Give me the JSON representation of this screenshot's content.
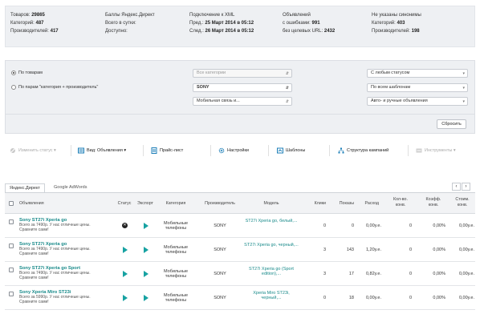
{
  "stats": {
    "col1": {
      "items": [
        {
          "label": "Товаров:",
          "value": "29865"
        },
        {
          "label": "Категорий:",
          "value": "487"
        },
        {
          "label": "Производителей:",
          "value": "417"
        }
      ]
    },
    "col2": {
      "items": [
        {
          "label": "Баллы Яндекс.Директ",
          "value": ""
        },
        {
          "label": "Всего в сутки:",
          "value": ""
        },
        {
          "label": "Доступно:",
          "value": ""
        }
      ]
    },
    "col3": {
      "items": [
        {
          "label": "Подключение к XML",
          "value": ""
        },
        {
          "label": "Пред.:",
          "value": "25 Март 2014 в 05:12"
        },
        {
          "label": "След.:",
          "value": "26 Март 2014 в 05:12"
        }
      ]
    },
    "col4": {
      "items": [
        {
          "label": "Объявлений",
          "value": ""
        },
        {
          "label": "с ошибками:",
          "value": "991"
        },
        {
          "label": "без целевых URL:",
          "value": "2432"
        }
      ]
    },
    "col5": {
      "items": [
        {
          "label": "Не указаны синонимы",
          "value": ""
        },
        {
          "label": "Категорий:",
          "value": "403"
        },
        {
          "label": "Производителей:",
          "value": "198"
        }
      ]
    }
  },
  "filter": {
    "radio_products": "По товарам",
    "radio_pairs": "По парам \"категория + производитель\"",
    "category_select": "Все категории",
    "brand_select": "SONY",
    "subcategory_select": "Мобильная связь и...",
    "status_select": "С любым статусом",
    "template_select": "По всем шаблонам",
    "mode_select": "Авто- и ручные объявления",
    "reset_button": "Сбросить"
  },
  "toolbar": {
    "change_status": "Изменить статус",
    "view": "Вид: Объявления",
    "pricelist": "Прайс-лист",
    "settings": "Настройки",
    "templates": "Шаблоны",
    "campaign_structure": "Структура кампаний",
    "tools": "Инструменты"
  },
  "tabs": {
    "yandex": "Яндекс.Директ",
    "adwords": "Google AdWords",
    "prev": "‹",
    "next": "›"
  },
  "columns": {
    "ads": "Объявления",
    "status": "Статус",
    "export": "Экспорт",
    "category": "Категория",
    "manufacturer": "Производитель",
    "model": "Модель",
    "clicks": "Клики",
    "impressions": "Показы",
    "cost": "Расход",
    "conversions": "Кол-во. конв.",
    "conv_rate": "Коэфф. конв.",
    "conv_cost": "Стоим. конв."
  },
  "rows": [
    {
      "title": "Sony ST27i Xperia go",
      "text": "Всего за 7490р. У нас отличные цены. Сравните сами!",
      "status": "stopped",
      "category": "Мобильные телефоны",
      "manufacturer": "SONY",
      "model": "ST27i Xperia go, белый,...",
      "clicks": "0",
      "impressions": "0",
      "cost": "0,00у.е.",
      "conversions": "0",
      "conv_rate": "0,00%",
      "conv_cost": "0,00у.е."
    },
    {
      "title": "Sony ST27i Xperia go",
      "text": "Всего за 7490р. У нас отличные цены. Сравните сами!",
      "status": "active",
      "category": "Мобильные телефоны",
      "manufacturer": "SONY",
      "model": "ST27i Xperia go, черный,...",
      "clicks": "3",
      "impressions": "143",
      "cost": "1,20у.е.",
      "conversions": "0",
      "conv_rate": "0,00%",
      "conv_cost": "0,00у.е."
    },
    {
      "title": "Sony ST27i Xperia go Sport",
      "text": "Всего за 7490р. У нас отличные цены. Сравните сами!",
      "status": "active",
      "category": "Мобильные телефоны",
      "manufacturer": "SONY",
      "model": "ST27i Xperia go (Sport edition),...",
      "clicks": "3",
      "impressions": "17",
      "cost": "0,82у.е.",
      "conversions": "0",
      "conv_rate": "0,00%",
      "conv_cost": "0,00у.е."
    },
    {
      "title": "Sony Xperia Miro ST23i",
      "text": "Всего за 5990р. У нас отличные цены. Сравните сами!",
      "status": "active",
      "category": "Мобильные телефоны",
      "manufacturer": "SONY",
      "model": "Xperia Miro ST23i, черный,...",
      "clicks": "0",
      "impressions": "18",
      "cost": "0,00у.е.",
      "conversions": "0",
      "conv_rate": "0,00%",
      "conv_cost": "0,00у.е."
    }
  ]
}
